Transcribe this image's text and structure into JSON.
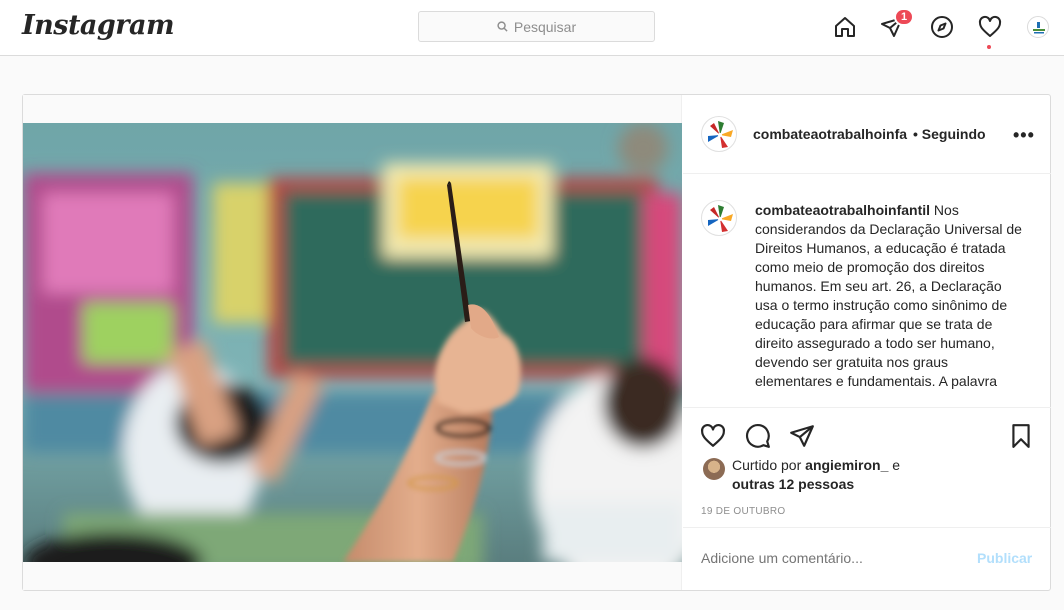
{
  "app": {
    "logo_text": "Instagram"
  },
  "search": {
    "placeholder": "Pesquisar"
  },
  "nav": {
    "icons": [
      "home-icon",
      "direct-icon",
      "explore-icon",
      "activity-icon",
      "profile-avatar"
    ],
    "direct_badge": "1"
  },
  "post": {
    "username": "combateaotrabalhoinfantil",
    "header_username": "combateaotrabalhoinfa",
    "follow_status": "• Seguindo",
    "more_label": "•••",
    "caption_text": "Nos considerandos da Declaração Universal de Direitos Humanos, a educação é tratada como meio de promoção dos direitos humanos. Em seu art. 26, a Declaração usa o termo instrução como sinônimo de educação para afirmar que se trata de direito assegurado a todo ser humano, devendo ser gratuita nos graus elementares e fundamentais. A palavra",
    "liked_prefix": "Curtido por",
    "liked_user": "angiemiron_",
    "liked_e": "e",
    "liked_others": "outras 12 pessoas",
    "date": "19 DE OUTUBRO",
    "comment_placeholder": "Adicione um comentário...",
    "publish_label": "Publicar"
  },
  "colors": {
    "badge": "#ed4956",
    "publish_disabled": "#b2dffc",
    "border": "#dbdbdb",
    "muted": "#8e8e8e"
  }
}
